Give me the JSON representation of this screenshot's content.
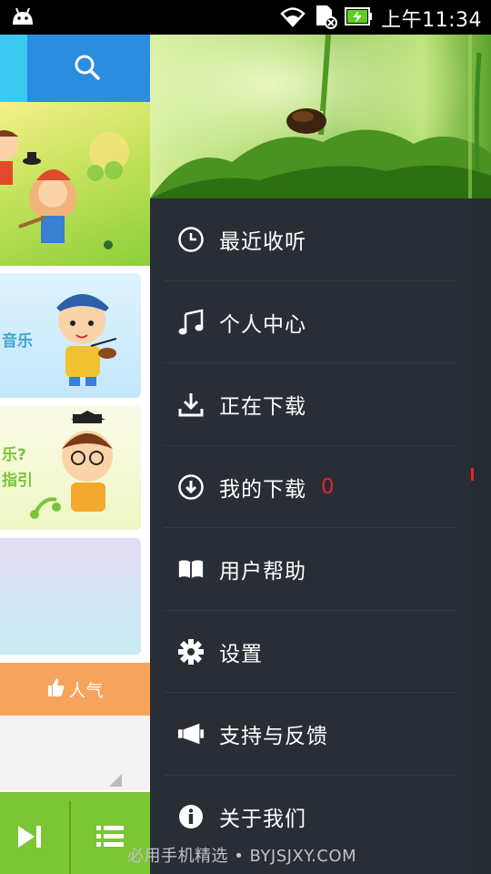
{
  "status_bar": {
    "time": "上午11:34"
  },
  "background_app": {
    "card_texts": [
      "音乐",
      "乐?",
      "指引"
    ],
    "popular_label": "人气"
  },
  "drawer": {
    "menu": [
      {
        "label": "最近收听",
        "icon": "clock-icon"
      },
      {
        "label": "个人中心",
        "icon": "music-note-icon"
      },
      {
        "label": "正在下载",
        "icon": "download-icon"
      },
      {
        "label": "我的下载",
        "icon": "download-circle-icon",
        "count": "0"
      },
      {
        "label": "用户帮助",
        "icon": "book-icon"
      },
      {
        "label": "设置",
        "icon": "gear-icon"
      },
      {
        "label": "支持与反馈",
        "icon": "megaphone-icon"
      },
      {
        "label": "关于我们",
        "icon": "info-icon"
      }
    ]
  },
  "watermark": "必用手机精选 • BYJSJXY.COM",
  "colors": {
    "drawer_bg": "#292d35",
    "accent_green": "#7cc534",
    "accent_blue": "#2a8de0",
    "count_red": "#e22525",
    "popular_orange": "#f7a35b"
  }
}
